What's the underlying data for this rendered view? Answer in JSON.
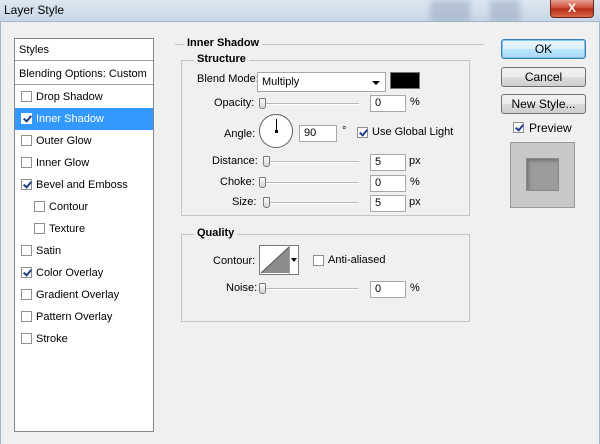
{
  "window": {
    "title": "Layer Style",
    "close_glyph": "X"
  },
  "styles_list": {
    "header": "Styles",
    "blending": "Blending Options: Custom",
    "items": [
      {
        "label": "Drop Shadow",
        "checked": false
      },
      {
        "label": "Inner Shadow",
        "checked": true
      },
      {
        "label": "Outer Glow",
        "checked": false
      },
      {
        "label": "Inner Glow",
        "checked": false
      },
      {
        "label": "Bevel and Emboss",
        "checked": true
      },
      {
        "label": "Contour",
        "checked": false
      },
      {
        "label": "Texture",
        "checked": false
      },
      {
        "label": "Satin",
        "checked": false
      },
      {
        "label": "Color Overlay",
        "checked": true
      },
      {
        "label": "Gradient Overlay",
        "checked": false
      },
      {
        "label": "Pattern Overlay",
        "checked": false
      },
      {
        "label": "Stroke",
        "checked": false
      }
    ]
  },
  "inner_shadow": {
    "title": "Inner Shadow",
    "structure": {
      "title": "Structure",
      "blend_mode_label": "Blend Mode:",
      "blend_mode_value": "Multiply",
      "blend_color": "#000000",
      "opacity_label": "Opacity:",
      "opacity_value": "0",
      "opacity_unit": "%",
      "angle_label": "Angle:",
      "angle_value": "90",
      "angle_unit": "°",
      "global_light_label": "Use Global Light",
      "global_light_checked": true,
      "distance_label": "Distance:",
      "distance_value": "5",
      "distance_unit": "px",
      "choke_label": "Choke:",
      "choke_value": "0",
      "choke_unit": "%",
      "size_label": "Size:",
      "size_value": "5",
      "size_unit": "px"
    },
    "quality": {
      "title": "Quality",
      "contour_label": "Contour:",
      "anti_aliased_label": "Anti-aliased",
      "anti_aliased_checked": false,
      "noise_label": "Noise:",
      "noise_value": "0",
      "noise_unit": "%"
    }
  },
  "buttons": {
    "ok": "OK",
    "cancel": "Cancel",
    "new_style": "New Style..."
  },
  "preview": {
    "label": "Preview",
    "checked": true
  }
}
